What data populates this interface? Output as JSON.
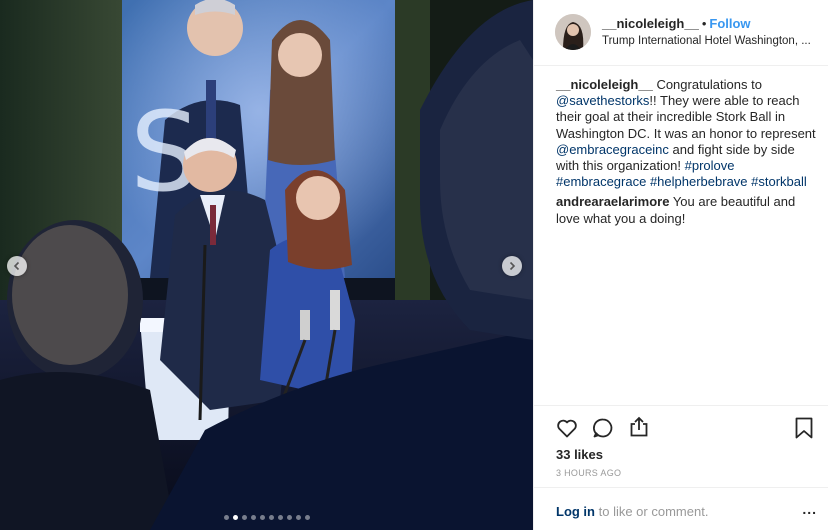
{
  "post": {
    "username": "__nicoleleigh__",
    "separator": "•",
    "follow_label": "Follow",
    "location": "Trump International Hotel Washington, ..."
  },
  "comments": {
    "caption_user": "__nicoleleigh__",
    "caption_t1": " Congratulations to ",
    "mention1": "@savethestorks",
    "caption_t2": "!! They were able to reach their goal at their incredible Stork Ball in Washington DC. It was an honor to represent ",
    "mention2": "@embracegraceinc",
    "caption_t3": " and fight side by side with this organization! ",
    "hashtag1": "#prolove",
    "hashtag2": "#embracegrace",
    "hashtag3": "#helpherbebrave",
    "hashtag4": "#storkball",
    "reply_user": "andrearaelarimore",
    "reply_text": " You are beautiful and love what you a doing!"
  },
  "actions": {
    "likes": "33 likes",
    "timestamp": "3 HOURS AGO",
    "icons": [
      "heart-icon",
      "comment-icon",
      "share-icon",
      "bookmark-icon"
    ]
  },
  "footer": {
    "login_link": "Log in",
    "login_suffix": " to like or comment.",
    "more_label": "..."
  },
  "carousel": {
    "dot_count": 10,
    "active_index": 1
  },
  "colors": {
    "link_blue": "#3897f0",
    "hashtag_navy": "#003569",
    "muted_gray": "#999999",
    "border": "#efefef"
  }
}
